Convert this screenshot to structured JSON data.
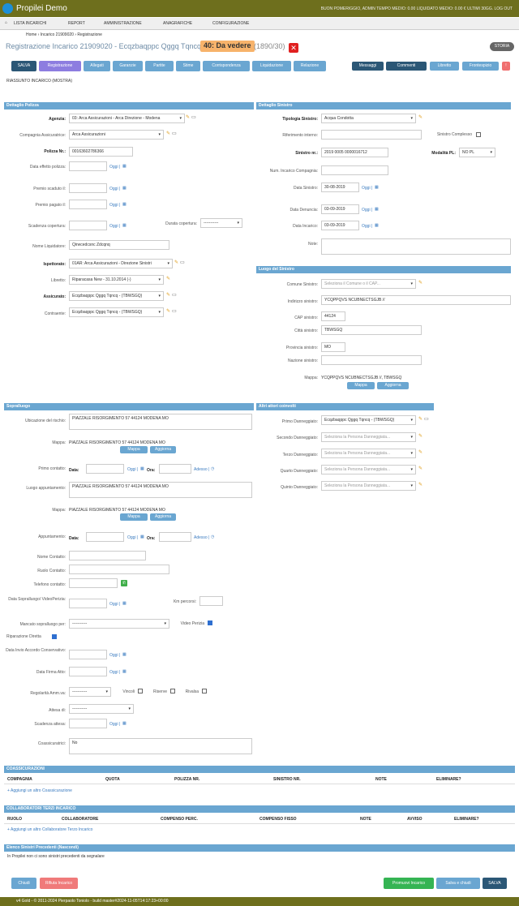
{
  "app": {
    "title": "Propilei Demo"
  },
  "topbar": {
    "status": "BUON POMERIGGIO, ADMIN   TEMPO MEDIO: 0.00 LIQUIDATO MEDIO: 0.00 € ULTIMI 30GG.  LOG OUT"
  },
  "menu": [
    "LISTA INCARICHI",
    "REPORT",
    "AMMINISTRAZIONE",
    "ANAGRAFICHE",
    "CONFIGURAZIONE"
  ],
  "breadcrumb": "Home › Incarico 21909020 › Registrazione",
  "header": {
    "title": "Registrazione Incarico 21909020 - Ecqzbaqppc Qggq Tqncq",
    "badge": "40: Da vedere",
    "count": "(1890/30)",
    "storia": "STORIA"
  },
  "tabs": [
    "SALVA",
    "Registrazione",
    "Allegati",
    "Garanzie",
    "Partite",
    "Stime",
    "Corrispondenza",
    "Liquidazione",
    "Relazione"
  ],
  "right_tabs": [
    "Messaggi",
    "Commenti",
    "Libretto",
    "Frontespizio",
    "!"
  ],
  "riassunto": "RIASSUNTO INCARICO (MOSTRA)",
  "polizza": {
    "header": "Dettaglio Polizza",
    "agenzia_l": "Agenzia:",
    "agenzia": "03: Arca Assicurazioni - Arca Direzione - Modena",
    "compagnia_l": "Compagnia Assicuratrice:",
    "compagnia": "Arca Assicurazioni",
    "polizza_l": "Polizza Nr.:",
    "polizza": "00163602786366",
    "effetto_l": "Data effetto polizza:",
    "scaduto_l": "Premio scaduto il:",
    "pagato_l": "Premio pagato il:",
    "scadenza_l": "Scadenza copertura:",
    "durata_l": "Durata copertura:",
    "durata": "-----------",
    "liquidatore_l": "Nome Liquidatore:",
    "liquidatore": "Qirwcedcsnc Zdcqnq",
    "ispettorato_l": "Ispettorato:",
    "ispettorato": "01AR: Arca Assicurazioni - Direzione Sinistri",
    "libretto_l": "Libretto:",
    "libretto": "Riparacasa New - 31.10.2014 (-)",
    "assicurato_l": "Assicurato:",
    "assicurato": "Ecqzbaqppc Qggq Tqncq - (TBWSGQ)",
    "contraente_l": "Contraente:",
    "contraente": "Ecqzbaqppc Qggq Tqncq - (TBWSGQ)",
    "oggi": "Oggi |"
  },
  "sinistro": {
    "header": "Dettaglio Sinistro",
    "tipologia_l": "Tipologia Sinistro:",
    "tipologia": "Acqua Condotta",
    "rif_l": "Riferimento interno:",
    "complesso_l": "Sinistro Complesso",
    "nr_l": "Sinistro nr.:",
    "nr": "2019 0005 0000016712",
    "modalita_l": "Modalità PL:",
    "modalita": "NO PL",
    "num_inc_l": "Num. Incarico Compagnia:",
    "data_sin_l": "Data Sinistro:",
    "data_sin": "30-08-2019",
    "denuncia_l": "Data Denuncia:",
    "denuncia": "03-09-2019",
    "incarico_l": "Data Incarico:",
    "incarico": "03-09-2019",
    "note_l": "Note:"
  },
  "luogo": {
    "header": "Luogo del Sinistro",
    "comune_l": "Comune Sinistro:",
    "comune": "Seleziona il Comune o il CAP...",
    "indirizzo_l": "Indirizzo sinistro:",
    "indirizzo": "YCQPPQVS NCUBNECTSGJB //",
    "cap_l": "CAP sinistro:",
    "cap": "44124",
    "citta_l": "Città sinistro:",
    "citta": "TBWSGQ",
    "prov_l": "Provincia sinistro:",
    "prov": "MO",
    "nazione_l": "Nazione sinistro:",
    "mappa_l": "Mappa:",
    "mappa": "YCQPPQVS NCUBNECTSGJB //, TBWSGQ",
    "mappa_btn": "Mappa",
    "aggiorna_btn": "Aggiorna"
  },
  "sopralluogo": {
    "header": "Sopralluogo",
    "ubicazione_l": "Ubicazione del rischio:",
    "ubicazione": "PIAZZALE RISORGIMENTO 57 44124 MODENA MO",
    "mappa_l": "Mappa:",
    "mappa": "PIAZZALE RISORGIMENTO 57 44124 MODENA MO",
    "primo_l": "Primo contatto:",
    "data_l": "Data:",
    "ora_l": "Ora:",
    "adesso": "Adesso |",
    "luogo_l": "Luogo appuntamento:",
    "luogo": "PIAZZALE RISORGIMENTO 57 44124 MODENA MO",
    "mappa2": "PIAZZALE RISORGIMENTO 57 44124 MODENA MO",
    "appuntamento_l": "Appuntamento:",
    "nome_l": "Nome Contatto:",
    "ruolo_l": "Ruolo Contatto:",
    "tel_l": "Telefono contatto:",
    "data_sopr_l": "Data Sopralluogo/ VideoPerizia:",
    "km_l": "Km percorsi:",
    "mancato_l": "Mancato sopralluogo per:",
    "mancato": "-----------",
    "video_l": "Video Perizia",
    "ripar_l": "Riparazione Diretta",
    "invio_l": "Data Invio Accordo Conservativo:",
    "firma_l": "Data Firma Atto:",
    "regolarita_l": "Regolarità Amm.va:",
    "regolarita": "-----------",
    "vincoli_l": "Vincoli",
    "riserve_l": "Riserve",
    "rivalsa_l": "Rivalsa",
    "attesa_l": "Attesa di:",
    "attesa": "-----------",
    "scad_attesa_l": "Scadenza attesa:",
    "coass_l": "Coassicuratrici:",
    "coass": "No"
  },
  "attori": {
    "header": "Altri attori coinvolti",
    "primo_l": "Primo Danneggiato:",
    "primo": "Ecqzbaqppc Qggq Tqncq - (TBWSGQ)",
    "secondo_l": "Secondo Danneggiato:",
    "terzo_l": "Terzo Danneggiato:",
    "quarto_l": "Quarto Danneggiato:",
    "quinto_l": "Quinto Danneggiato:",
    "placeholder": "Seleziona la Persona Danneggiata..."
  },
  "coass_tbl": {
    "header": "COASSICURAZIONI",
    "cols": [
      "COMPAGNIA",
      "QUOTA",
      "POLIZZA NR.",
      "SINISTRO NR.",
      "NOTE",
      "ELIMINARE?"
    ],
    "add": "+ Aggiungi un altro Coassicurazione"
  },
  "collab_tbl": {
    "header": "COLLABORATORI TERZI INCARICO",
    "cols": [
      "RUOLO",
      "COLLABORATORE",
      "COMPENSO PERC.",
      "COMPENSO FISSO",
      "NOTE",
      "AVVISO",
      "ELIMINARE?"
    ],
    "add": "+ Aggiungi un altro Collaboratore Terzo Incarico"
  },
  "precedenti": {
    "header": "Elenco Sinistri Precedenti (Nascondi)",
    "text": "In Propilei non ci sono sinistri precedenti da segnalare"
  },
  "bottom": {
    "chiudi": "Chiudi",
    "rifiuta": "Rifiuta Incarico",
    "promuovi": "Promuovi Incarico",
    "salva_chiudi": "Salva e chiudi",
    "salva": "SALVA"
  },
  "footer": "v4 Gold - © 2011-2024 Pierpaolo Toniolo - build master#2024-11-05T14:17:23+00:00"
}
